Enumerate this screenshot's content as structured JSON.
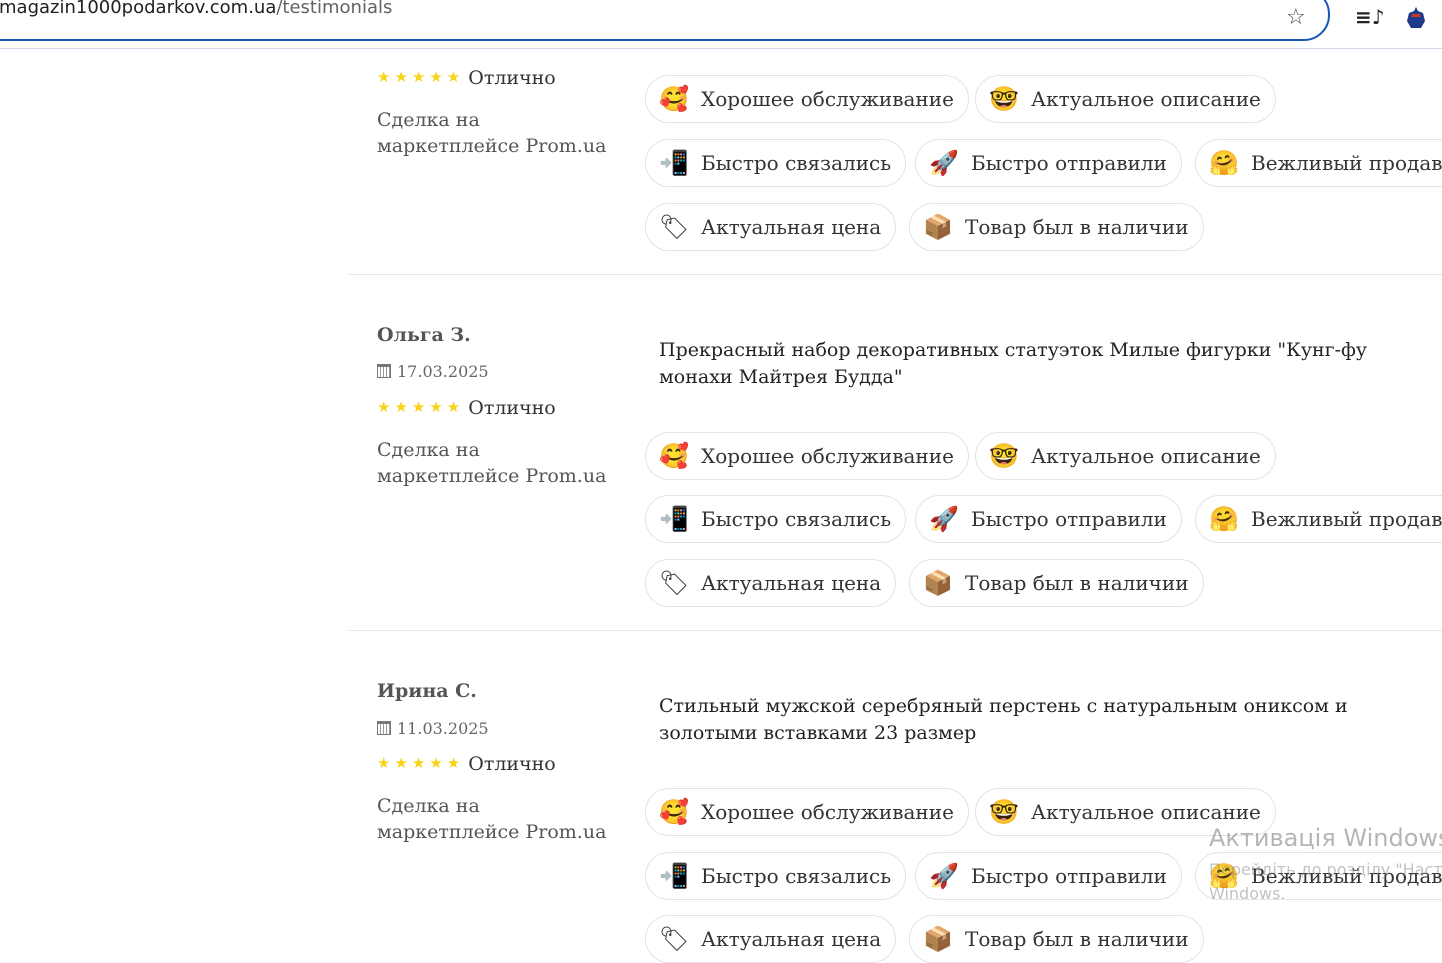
{
  "browser": {
    "url_host": "magazin1000podarkov.com.ua",
    "url_path": "/testimonials",
    "star_icon": "star-icon",
    "playlist_icon": "playlist-icon",
    "extension_icon": "extension-icon"
  },
  "chips": {
    "good_service": "Хорошее обслуживание",
    "actual_description": "Актуальное описание",
    "quick_contact": "Быстро связались",
    "quick_shipping": "Быстро отправили",
    "polite_seller": "Вежливый продавец",
    "actual_price": "Актуальная цена",
    "in_stock": "Товар был в наличии"
  },
  "reviews": [
    {
      "rating_label": "Отлично",
      "deal": "Сделка на маркетплейсе Prom.ua"
    },
    {
      "author": "Ольга З.",
      "date": "17.03.2025",
      "rating_label": "Отлично",
      "deal": "Сделка на маркетплейсе Prom.ua",
      "product": "Прекрасный набор декоративных статуэток Милые фигурки \"Кунг-фу монахи Майтрея Будда\""
    },
    {
      "author": "Ирина С.",
      "date": "11.03.2025",
      "rating_label": "Отлично",
      "deal": "Сделка на маркетплейсе Prom.ua",
      "product": "Стильный мужской серебряный перстень с натуральным ониксом и золотыми вставками 23 размер"
    }
  ],
  "stars": "★★★★★",
  "watermark": {
    "title": "Активація Windows",
    "line1": "Перейдіть до розділу \"Настр",
    "line2": "Windows."
  }
}
